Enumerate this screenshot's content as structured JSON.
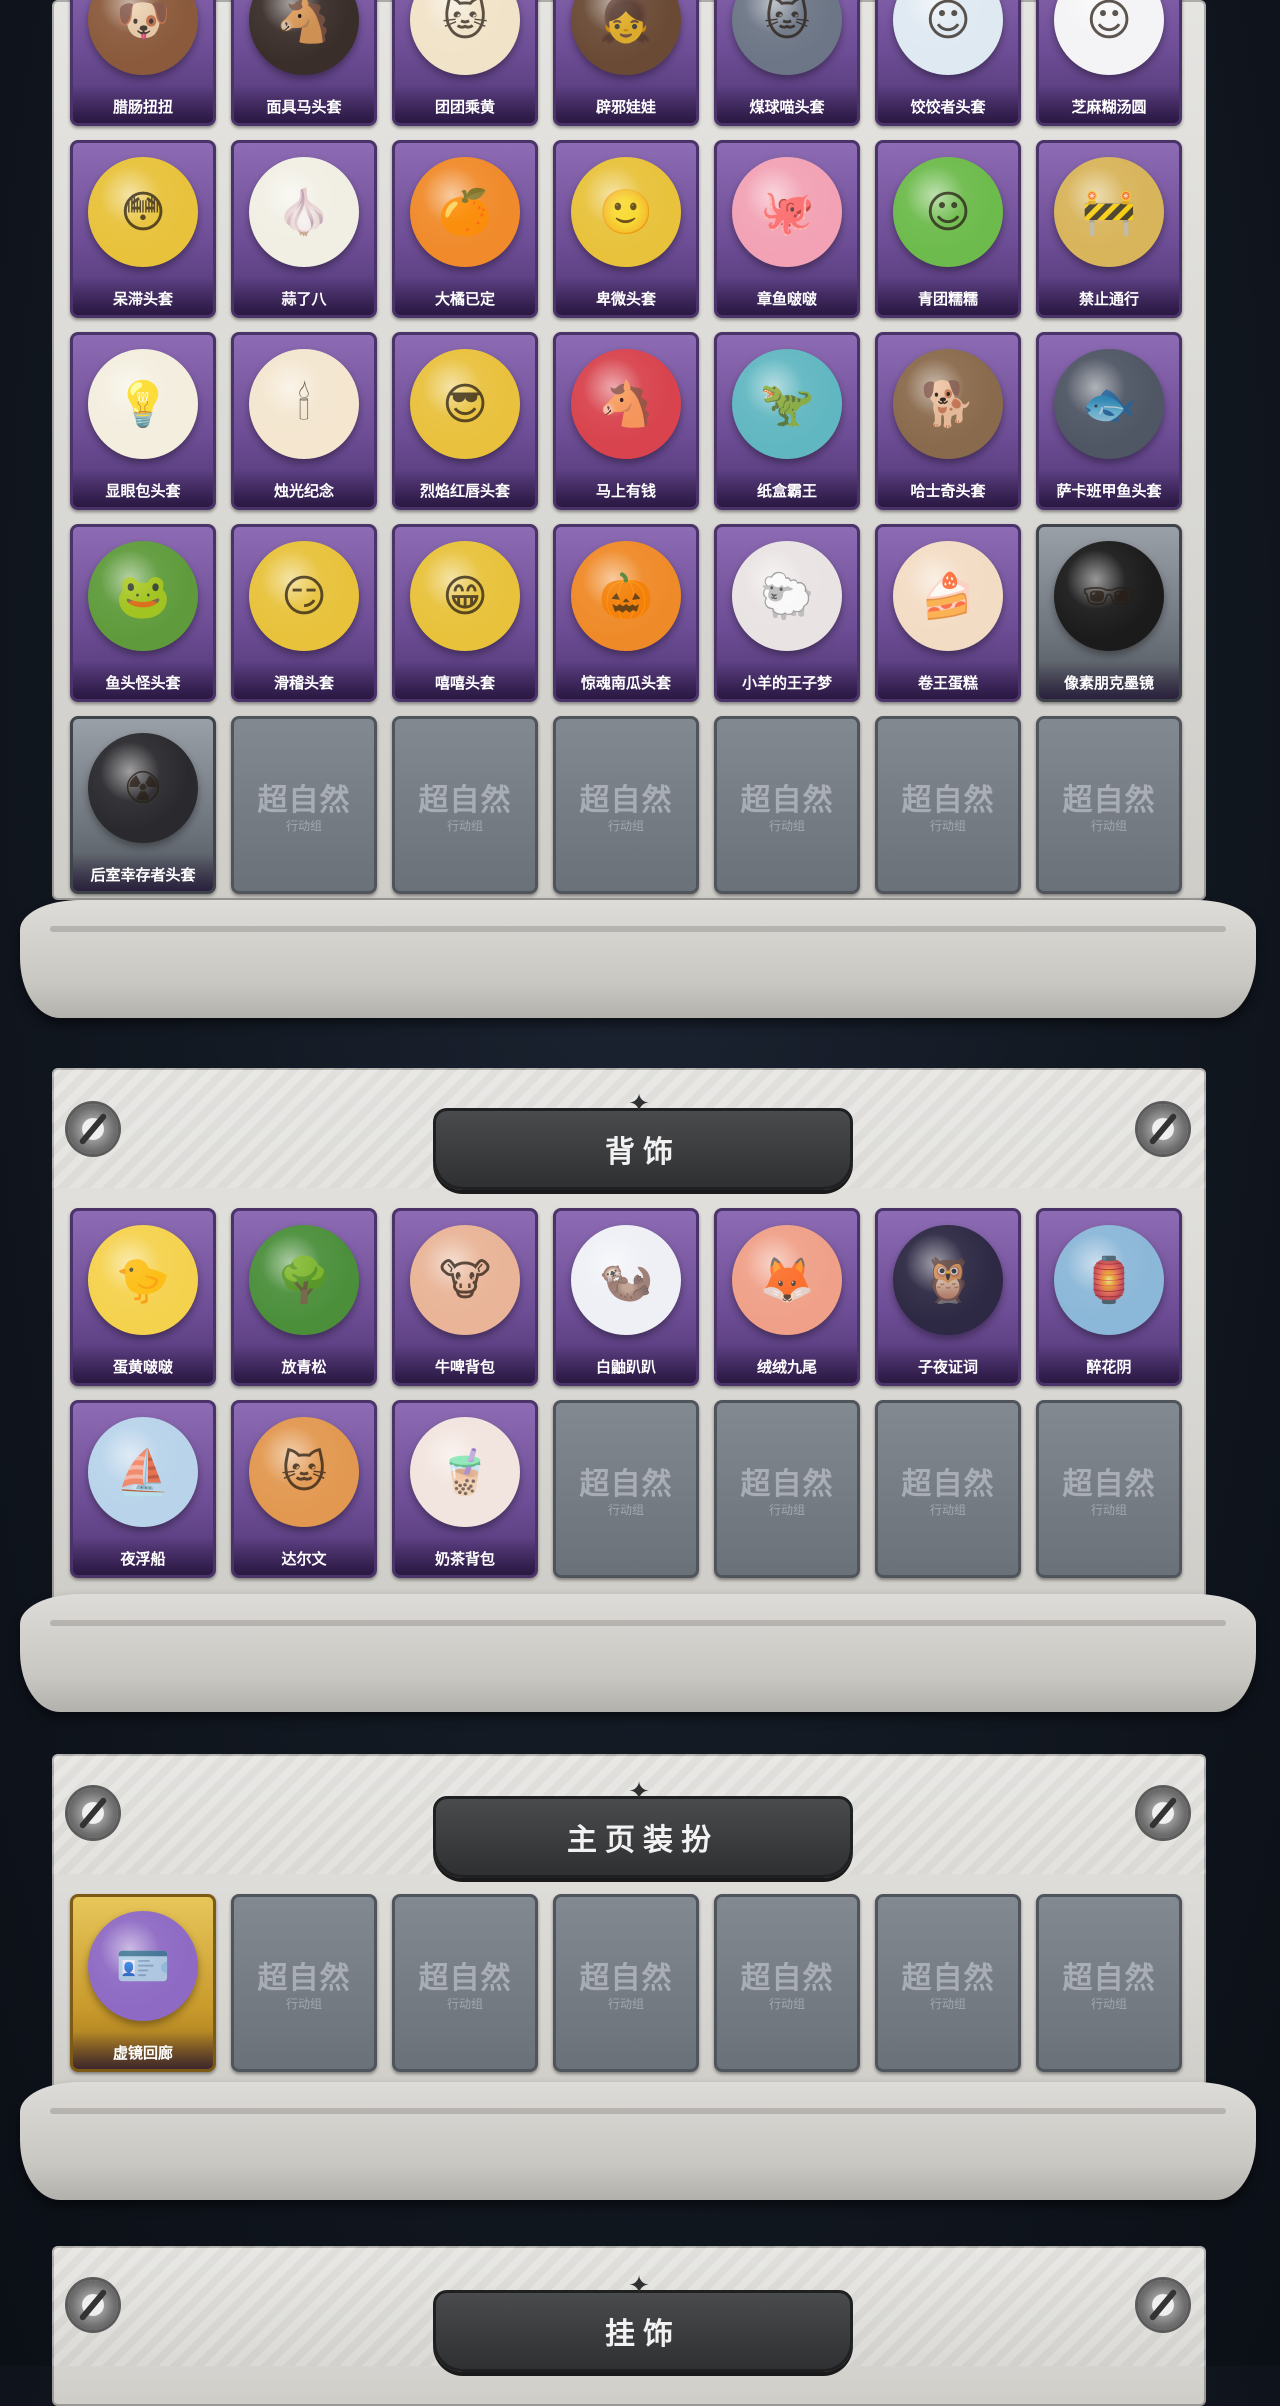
{
  "sections": {
    "headwear": {
      "items": [
        {
          "label": "腊肠扭扭",
          "color": "#8b5a3c",
          "glyph": "🐶"
        },
        {
          "label": "面具马头套",
          "color": "#3a2e2a",
          "glyph": "🐴"
        },
        {
          "label": "团团乘黄",
          "color": "#f1e3c8",
          "glyph": "🐱"
        },
        {
          "label": "辟邪娃娃",
          "color": "#6a4a35",
          "glyph": "👧"
        },
        {
          "label": "煤球喵头套",
          "color": "#6d7686",
          "glyph": "🐱"
        },
        {
          "label": "饺饺者头套",
          "color": "#dfe9f2",
          "glyph": "☺"
        },
        {
          "label": "芝麻糊汤圆",
          "color": "#f4f4f6",
          "glyph": "☺"
        },
        {
          "label": "呆滞头套",
          "color": "#e8c23b",
          "glyph": "😳"
        },
        {
          "label": "蒜了八",
          "color": "#f1efe4",
          "glyph": "🧄"
        },
        {
          "label": "大橘已定",
          "color": "#f08a2a",
          "glyph": "🍊"
        },
        {
          "label": "卑微头套",
          "color": "#e8c23b",
          "glyph": "🙂"
        },
        {
          "label": "章鱼啵啵",
          "color": "#f2a2b4",
          "glyph": "🐙"
        },
        {
          "label": "青团糯糯",
          "color": "#6dbb4c",
          "glyph": "☺"
        },
        {
          "label": "禁止通行",
          "color": "#d8b45a",
          "glyph": "🚧"
        },
        {
          "label": "显眼包头套",
          "color": "#f3eede",
          "glyph": "💡"
        },
        {
          "label": "烛光纪念",
          "color": "#f4e6cf",
          "glyph": "🕯"
        },
        {
          "label": "烈焰红唇头套",
          "color": "#e9c13d",
          "glyph": "😎"
        },
        {
          "label": "马上有钱",
          "color": "#d8434d",
          "glyph": "🐴"
        },
        {
          "label": "纸盒霸王",
          "color": "#61b7c1",
          "glyph": "🦖"
        },
        {
          "label": "哈士奇头套",
          "color": "#8a6a4c",
          "glyph": "🐕"
        },
        {
          "label": "萨卡班甲鱼头套",
          "color": "#4f5664",
          "glyph": "🐟"
        },
        {
          "label": "鱼头怪头套",
          "color": "#5f9b3c",
          "glyph": "🐸"
        },
        {
          "label": "滑稽头套",
          "color": "#e8c23b",
          "glyph": "😏"
        },
        {
          "label": "嘻嘻头套",
          "color": "#e8c23b",
          "glyph": "😁"
        },
        {
          "label": "惊魂南瓜头套",
          "color": "#ef8a28",
          "glyph": "🎃"
        },
        {
          "label": "小羊的王子梦",
          "color": "#e9e4e3",
          "glyph": "🐑"
        },
        {
          "label": "卷王蛋糕",
          "color": "#f3dcc4",
          "glyph": "🍰"
        },
        {
          "label": "像素朋克墨镜",
          "color": "#1b1b1b",
          "glyph": "🕶",
          "tier": "silver"
        },
        {
          "label": "后室幸存者头套",
          "color": "#2a2a2e",
          "glyph": "☢",
          "tier": "silver"
        },
        {
          "empty": true
        },
        {
          "empty": true
        },
        {
          "empty": true
        },
        {
          "empty": true
        },
        {
          "empty": true
        },
        {
          "empty": true
        }
      ]
    },
    "back": {
      "title": "背饰",
      "items": [
        {
          "label": "蛋黄啵啵",
          "color": "#f5d24e",
          "glyph": "🐤"
        },
        {
          "label": "放青松",
          "color": "#4b8f3b",
          "glyph": "🌳"
        },
        {
          "label": "牛啤背包",
          "color": "#e9b497",
          "glyph": "🐮"
        },
        {
          "label": "白鼬趴趴",
          "color": "#eef0f6",
          "glyph": "🦦"
        },
        {
          "label": "绒绒九尾",
          "color": "#f0a088",
          "glyph": "🦊"
        },
        {
          "label": "子夜证词",
          "color": "#2d2944",
          "glyph": "🦉"
        },
        {
          "label": "醉花阴",
          "color": "#8bb7d8",
          "glyph": "🏮"
        },
        {
          "label": "夜浮船",
          "color": "#b8d3ea",
          "glyph": "⛵"
        },
        {
          "label": "达尔文",
          "color": "#e29850",
          "glyph": "🐱"
        },
        {
          "label": "奶茶背包",
          "color": "#f2e4de",
          "glyph": "🧋"
        },
        {
          "empty": true
        },
        {
          "empty": true
        },
        {
          "empty": true
        },
        {
          "empty": true
        }
      ]
    },
    "homepage": {
      "title": "主页装扮",
      "items": [
        {
          "label": "虚镜回廊",
          "color": "#8e6ac4",
          "glyph": "🪪",
          "tier": "gold"
        },
        {
          "empty": true
        },
        {
          "empty": true
        },
        {
          "empty": true
        },
        {
          "empty": true
        },
        {
          "empty": true
        },
        {
          "empty": true
        }
      ]
    },
    "hanging": {
      "title": "挂饰"
    }
  },
  "watermark": {
    "title": "超自然",
    "subtitle": "行动组"
  }
}
